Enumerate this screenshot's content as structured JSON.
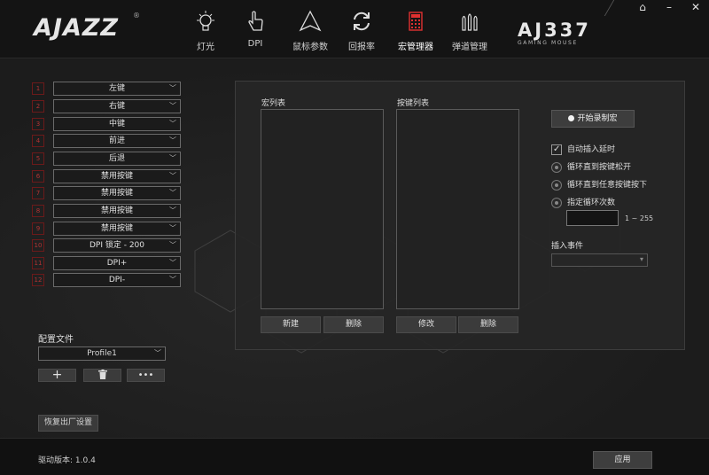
{
  "header": {
    "logo": "AJAZZ",
    "logo_mark": "®",
    "model": "AJ337",
    "model_sub": "GAMING MOUSE",
    "nav": [
      {
        "label": "灯光",
        "icon": "bulb-icon"
      },
      {
        "label": "DPI",
        "icon": "hand-pointer-icon"
      },
      {
        "label": "鼠标参数",
        "icon": "cursor-triangle-icon"
      },
      {
        "label": "回报率",
        "icon": "refresh-icon"
      },
      {
        "label": "宏管理器",
        "icon": "calculator-icon",
        "active": true
      },
      {
        "label": "弹道管理",
        "icon": "bullets-icon"
      }
    ],
    "window_controls": {
      "home": "⌂",
      "minimize": "–",
      "close": "✕"
    }
  },
  "keys": [
    {
      "num": "1",
      "value": "左键"
    },
    {
      "num": "2",
      "value": "右键"
    },
    {
      "num": "3",
      "value": "中键"
    },
    {
      "num": "4",
      "value": "前进"
    },
    {
      "num": "5",
      "value": "后退"
    },
    {
      "num": "6",
      "value": "禁用按键"
    },
    {
      "num": "7",
      "value": "禁用按键"
    },
    {
      "num": "8",
      "value": "禁用按键"
    },
    {
      "num": "9",
      "value": "禁用按键"
    },
    {
      "num": "10",
      "value": "DPI 锁定 - 200"
    },
    {
      "num": "11",
      "value": "DPI+"
    },
    {
      "num": "12",
      "value": "DPI-"
    }
  ],
  "config": {
    "label": "配置文件",
    "profile": "Profile1",
    "add": "+",
    "more": "•••",
    "reset": "恢复出厂设置"
  },
  "macro": {
    "list_label": "宏列表",
    "keys_label": "按键列表",
    "new": "新建",
    "delete": "删除",
    "modify": "修改",
    "delete2": "删除",
    "record": "开始录制宏",
    "auto_delay": "自动插入延时",
    "loop_release": "循环直到按键松开",
    "loop_any": "循环直到任意按键按下",
    "loop_count": "指定循环次数",
    "range": "1 ~ 255",
    "insert_event": "插入事件"
  },
  "footer": {
    "version": "驱动版本: 1.0.4",
    "apply": "应用"
  }
}
